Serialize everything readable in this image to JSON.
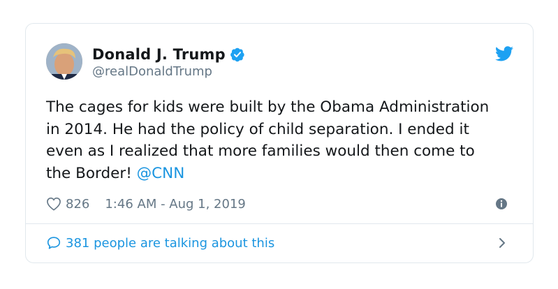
{
  "user": {
    "display_name": "Donald J. Trump",
    "handle": "@realDonaldTrump",
    "verified": true
  },
  "tweet": {
    "text": "The cages for kids were built by the Obama Administration in 2014. He had the policy of child separation. I ended it even as I realized that more families would then come to the Border!",
    "mention": "@CNN"
  },
  "meta": {
    "likes": "826",
    "timestamp": "1:46 AM - Aug 1, 2019"
  },
  "footer": {
    "talking_label": "381 people are talking about this"
  },
  "icons": {
    "verified": "verified-badge-icon",
    "brand": "twitter-bird-icon",
    "like": "heart-icon",
    "info": "info-icon",
    "reply": "speech-bubble-icon",
    "chevron": "chevron-right-icon"
  },
  "colors": {
    "accent": "#1b95e0",
    "secondary_text": "#657786",
    "border": "#e1e8ed"
  }
}
